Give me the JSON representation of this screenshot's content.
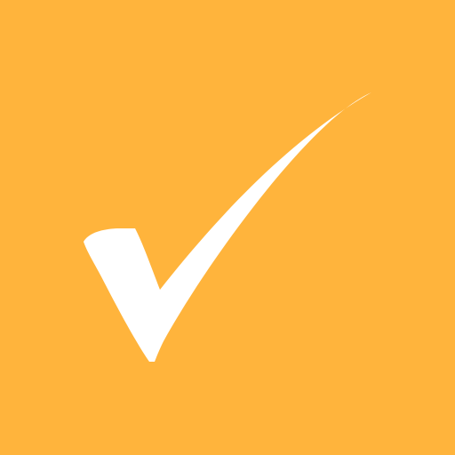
{
  "icon": {
    "name": "checkmark-icon",
    "background_color": "#FFB43C",
    "mark_color": "#FFFFFF"
  }
}
